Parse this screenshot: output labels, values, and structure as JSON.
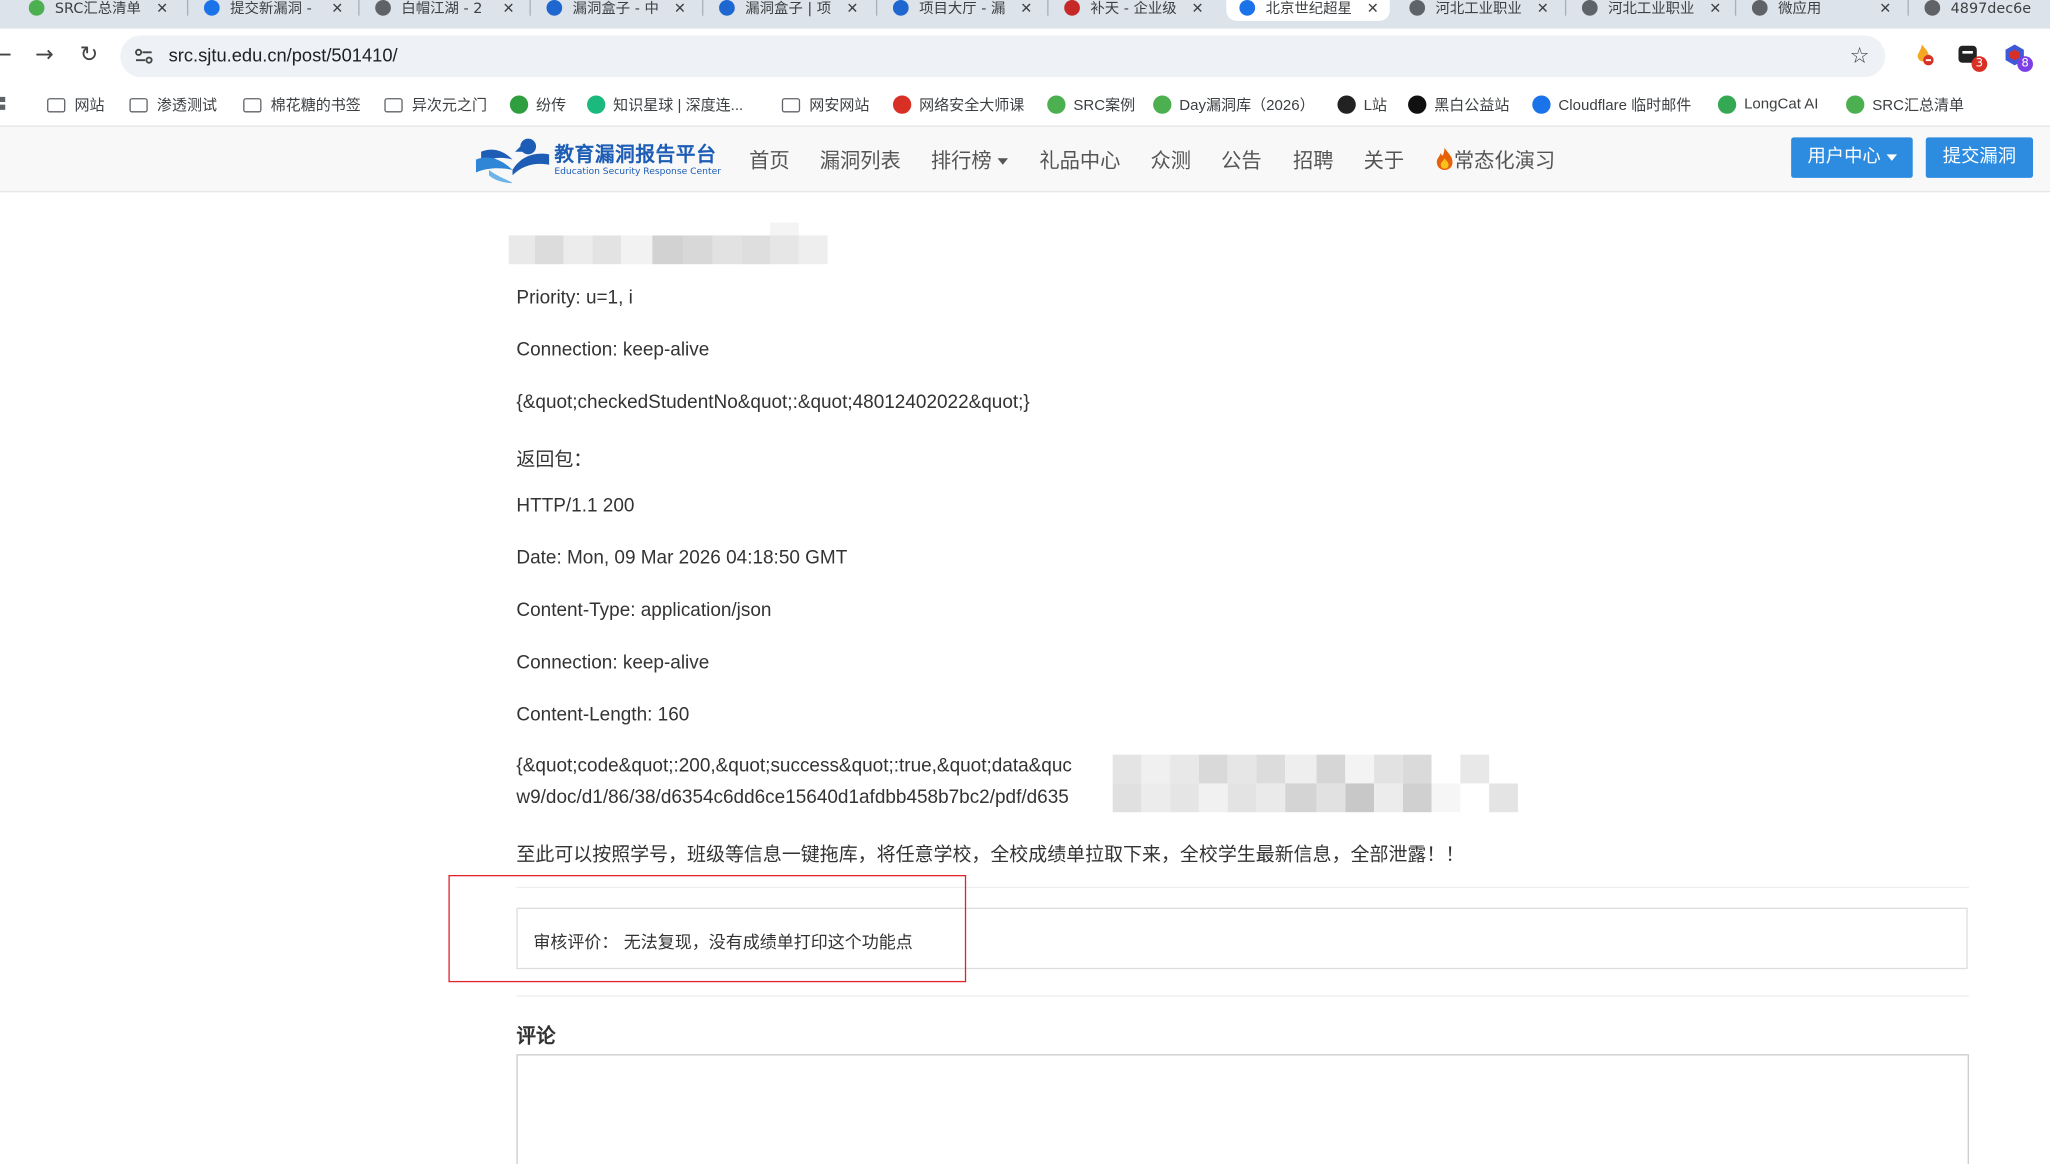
{
  "browser": {
    "tabs": [
      {
        "title": "SRC汇总清单",
        "icon_color": "#4caf50",
        "active": false
      },
      {
        "title": "提交新漏洞 -",
        "icon_color": "#1a73e8",
        "active": false
      },
      {
        "title": "白帽江湖 - 2",
        "icon_color": "#5f6368",
        "active": false
      },
      {
        "title": "漏洞盒子 - 中",
        "icon_color": "#1e66d0",
        "active": false
      },
      {
        "title": "漏洞盒子 | 项",
        "icon_color": "#1e66d0",
        "active": false
      },
      {
        "title": "项目大厅 - 漏",
        "icon_color": "#1e66d0",
        "active": false
      },
      {
        "title": "补天 - 企业级",
        "icon_color": "#c62828",
        "active": false
      },
      {
        "title": "北京世纪超星",
        "icon_color": "#1a73e8",
        "active": true
      },
      {
        "title": "河北工业职业",
        "icon_color": "#5f6368",
        "active": false
      },
      {
        "title": "河北工业职业",
        "icon_color": "#5f6368",
        "active": false
      },
      {
        "title": "微应用",
        "icon_color": "#5f6368",
        "active": false
      },
      {
        "title": "4897dec6e",
        "icon_color": "#5f6368",
        "active": false
      }
    ],
    "tab_close_glyph": "✕",
    "url": "src.sjtu.edu.cn/post/501410/",
    "nav": {
      "back": "←",
      "forward": "→",
      "reload": "↻"
    },
    "star_glyph": "☆",
    "extensions": [
      {
        "name": "fire-extension",
        "badge": ""
      },
      {
        "name": "ext-red-badge",
        "badge": "3",
        "badge_color": "#d93025"
      },
      {
        "name": "ext-blue-badge",
        "badge": "8",
        "badge_color": "#7b3fe4"
      }
    ],
    "bookmarks": [
      {
        "label": "网站",
        "type": "folder"
      },
      {
        "label": "渗透测试",
        "type": "folder"
      },
      {
        "label": "棉花糖的书签",
        "type": "folder"
      },
      {
        "label": "异次元之门",
        "type": "folder"
      },
      {
        "label": "纷传",
        "type": "site",
        "icon_color": "#2e9e3e"
      },
      {
        "label": "知识星球 | 深度连...",
        "type": "site",
        "icon_color": "#1bb97e"
      },
      {
        "label": "网安网站",
        "type": "folder"
      },
      {
        "label": "网络安全大师课",
        "type": "site",
        "icon_color": "#d93025"
      },
      {
        "label": "SRC案例",
        "type": "site",
        "icon_color": "#4caf50"
      },
      {
        "label": "Day漏洞库（2026）",
        "type": "site",
        "icon_color": "#4caf50"
      },
      {
        "label": "L站",
        "type": "site",
        "icon_color": "#222222"
      },
      {
        "label": "黑白公益站",
        "type": "site",
        "icon_color": "#111111"
      },
      {
        "label": "Cloudflare 临时邮件",
        "type": "site",
        "icon_color": "#1a73e8"
      },
      {
        "label": "LongCat AI",
        "type": "site",
        "icon_color": "#34a853"
      },
      {
        "label": "SRC汇总清单",
        "type": "site",
        "icon_color": "#4caf50"
      }
    ]
  },
  "site": {
    "logo_cn": "教育漏洞报告平台",
    "logo_en": "Education Security Response Center",
    "nav": [
      {
        "label": "首页"
      },
      {
        "label": "漏洞列表"
      },
      {
        "label": "排行榜",
        "dropdown": true
      },
      {
        "label": "礼品中心"
      },
      {
        "label": "众测"
      },
      {
        "label": "公告"
      },
      {
        "label": "招聘"
      },
      {
        "label": "关于"
      },
      {
        "label": "常态化演习",
        "icon": "flame-icon"
      }
    ],
    "user_center_label": "用户中心",
    "submit_label": "提交漏洞",
    "accent_color": "#2d8ce0"
  },
  "article": {
    "lines": [
      "Priority: u=1, i",
      "Connection: keep-alive",
      "{&quot;checkedStudentNo&quot;:&quot;48012402022&quot;}",
      "返回包：",
      "HTTP/1.1 200",
      "Date: Mon, 09 Mar 2026 04:18:50 GMT",
      "Content-Type: application/json",
      "Connection: keep-alive",
      "Content-Length: 160",
      "{&quot;code&quot;:200,&quot;success&quot;:true,&quot;data&quc",
      "w9/doc/d1/86/38/d6354c6dd6ce15640d1afdbb458b7bc2/pdf/d635",
      "至此可以按照学号，班级等信息一键拖库，将任意学校，全校成绩单拉取下来，全校学生最新信息，全部泄露！！"
    ],
    "review": "审核评价： 无法复现，没有成绩单打印这个功能点",
    "comments_title": "评论"
  }
}
